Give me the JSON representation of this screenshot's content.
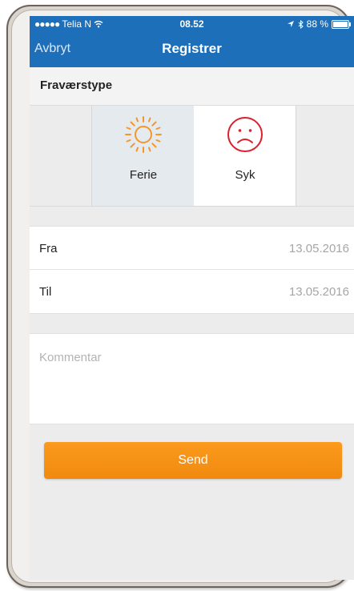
{
  "status_bar": {
    "carrier_dots": "●●●●●",
    "carrier": "Telia N",
    "time": "08.52",
    "battery": "88 %",
    "battery_level": 0.88
  },
  "nav": {
    "cancel_label": "Avbryt",
    "title": "Registrer"
  },
  "absence_type": {
    "header": "Fraværstype",
    "options": [
      {
        "label": "Ferie",
        "icon": "sun-icon",
        "color": "#f5962a",
        "selected": true
      },
      {
        "label": "Syk",
        "icon": "sad-face-icon",
        "color": "#d9202c",
        "selected": false
      }
    ]
  },
  "dates": {
    "from_label": "Fra",
    "from_value": "13.05.2016",
    "to_label": "Til",
    "to_value": "13.05.2016"
  },
  "comment": {
    "placeholder": "Kommentar"
  },
  "send": {
    "label": "Send"
  },
  "colors": {
    "brand_blue": "#1c6fb8",
    "accent_orange": "#f5921b"
  }
}
